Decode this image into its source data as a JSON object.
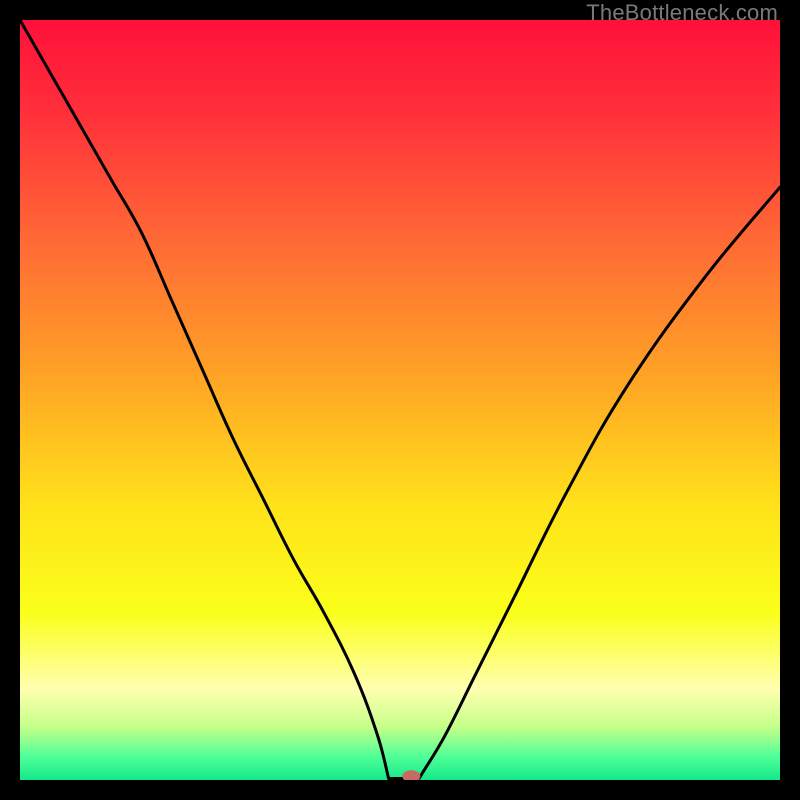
{
  "watermark": "TheBottleneck.com",
  "chart_data": {
    "type": "line",
    "title": "",
    "xlabel": "",
    "ylabel": "",
    "xlim": [
      0,
      100
    ],
    "ylim": [
      0,
      100
    ],
    "background_gradient": {
      "stops": [
        {
          "offset": 0.0,
          "color": "#ff103a"
        },
        {
          "offset": 0.12,
          "color": "#ff2f3a"
        },
        {
          "offset": 0.3,
          "color": "#ff6c35"
        },
        {
          "offset": 0.48,
          "color": "#ffa724"
        },
        {
          "offset": 0.64,
          "color": "#ffe21a"
        },
        {
          "offset": 0.78,
          "color": "#faff1a"
        },
        {
          "offset": 0.88,
          "color": "#ffffb0"
        },
        {
          "offset": 0.93,
          "color": "#c6ff8a"
        },
        {
          "offset": 0.97,
          "color": "#4dff97"
        },
        {
          "offset": 1.0,
          "color": "#15e88a"
        }
      ]
    },
    "series": [
      {
        "name": "bottleneck-curve",
        "x": [
          0,
          4,
          8,
          12,
          16,
          20,
          24,
          28,
          32,
          36,
          40,
          44,
          47,
          49,
          51,
          53,
          56,
          60,
          65,
          72,
          80,
          90,
          100
        ],
        "y": [
          100,
          93,
          86,
          79,
          72,
          63,
          54,
          45,
          37,
          29,
          22,
          14,
          6,
          1,
          0,
          1,
          6,
          14,
          24,
          38,
          52,
          66,
          78
        ]
      }
    ],
    "marker": {
      "name": "optimal-point",
      "x": 51.5,
      "y": 0.5,
      "color": "#c76a62",
      "rx": 9,
      "ry": 6
    },
    "flat_segment": {
      "x_start": 48.5,
      "x_end": 52.5,
      "y": 0.2
    }
  }
}
